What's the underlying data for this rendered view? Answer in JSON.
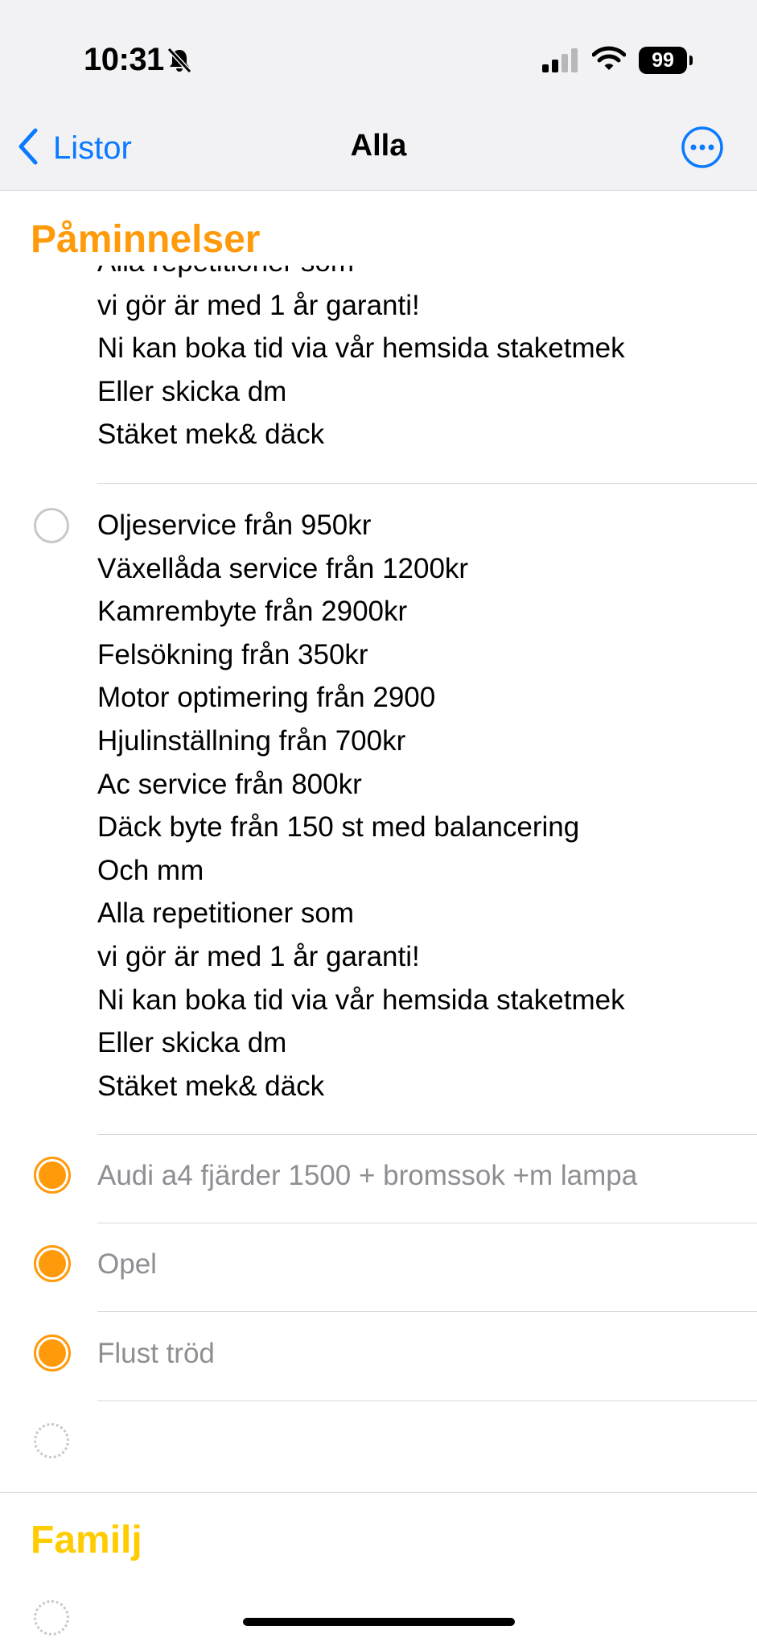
{
  "status_bar": {
    "time": "10:31",
    "battery": "99",
    "icons": [
      "bell-slash-icon",
      "cellular-signal-icon",
      "wifi-icon",
      "battery-icon"
    ]
  },
  "nav": {
    "back_label": "Listor",
    "title": "Alla",
    "more_icon": "ellipsis-circle-icon",
    "accent": "#0a7aff"
  },
  "sections": [
    {
      "title": "Påminnelser",
      "color": "#ff9a0b"
    },
    {
      "title": "Familj",
      "color": "#ffcc00"
    }
  ],
  "reminder_partial": {
    "cut_line": "Alla repetitioner som",
    "lines": [
      "vi gör är med 1 år garanti!",
      "Ni kan boka tid via vår hemsida staketmek",
      "Eller skicka dm",
      "Stäket mek& däck"
    ]
  },
  "reminder_full": {
    "lines": [
      "Oljeservice från 950kr",
      "Växellåda service från 1200kr",
      "Kamrembyte från 2900kr",
      "Felsökning från 350kr",
      "Motor optimering från 2900",
      "Hjulinställning från 700kr",
      "Ac service från 800kr",
      "Däck byte från 150 st med balancering",
      "Och mm",
      "Alla repetitioner som",
      "vi gör är med 1 år garanti!",
      "Ni kan boka tid via vår hemsida staketmek",
      "Eller skicka dm",
      "Stäket mek& däck"
    ]
  },
  "completed_items": [
    {
      "text": "Audi a4 fjärder 1500 + bromssok +m lampa"
    },
    {
      "text": "Opel"
    },
    {
      "text": "Flust tröd"
    }
  ]
}
